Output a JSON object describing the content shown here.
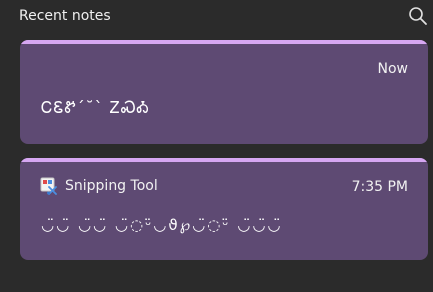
{
  "header": {
    "title": "Recent notes",
    "search_icon": "search-icon"
  },
  "notes": [
    {
      "time": "Now",
      "body": "ᏟᏋᏑ҆ˊ˘ˋ ᏃᏍᎣ"
    },
    {
      "app_icon": "snipping-tool-icon",
      "app_name": "Snipping Tool",
      "time": "7:35 PM",
      "body": "◡̈◡̈ ◡̈◡̈  ◡̈◌ᵕ̈◡ϑ℘◡̈◌ᵕ̈   ◡̈◡̈◡̈"
    }
  ],
  "colors": {
    "background": "#2b2b2b",
    "card": "#5e4a73",
    "accent": "#d6a7f2"
  }
}
